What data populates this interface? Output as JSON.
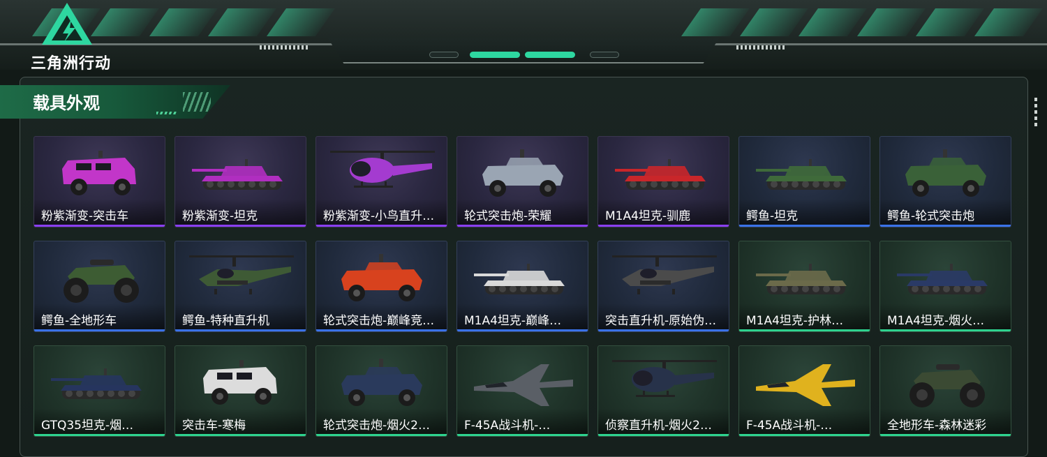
{
  "header": {
    "game_title": "三角洲行动",
    "colors": {
      "accent": "#2ed7a0",
      "panel": "#16201d"
    }
  },
  "section": {
    "title": "载具外观"
  },
  "rarity_colors": {
    "purple": "#8a3ff0",
    "blue": "#3a72e8",
    "green": "#2ed38f"
  },
  "cards": [
    {
      "name": "粉紫渐变-突击车",
      "rarity": "purple",
      "icon": "armored-car-icon",
      "paint": "#c236c9"
    },
    {
      "name": "粉紫渐变-坦克",
      "rarity": "purple",
      "icon": "tank-icon",
      "paint": "#b02ec0"
    },
    {
      "name": "粉紫渐变-小鸟直升…",
      "rarity": "purple",
      "icon": "helicopter-icon",
      "paint": "#a43bd0"
    },
    {
      "name": "轮式突击炮-荣耀",
      "rarity": "purple",
      "icon": "wheeled-vehicle-icon",
      "paint": "#9aa5b3"
    },
    {
      "name": "M1A4坦克-驯鹿",
      "rarity": "purple",
      "icon": "tank-icon",
      "paint": "#c9262a"
    },
    {
      "name": "鳄鱼-坦克",
      "rarity": "blue",
      "icon": "tank-icon",
      "paint": "#3f6a3a"
    },
    {
      "name": "鳄鱼-轮式突击炮",
      "rarity": "blue",
      "icon": "wheeled-vehicle-icon",
      "paint": "#3a6138"
    },
    {
      "name": "鳄鱼-全地形车",
      "rarity": "blue",
      "icon": "atv-icon",
      "paint": "#3d5c33"
    },
    {
      "name": "鳄鱼-特种直升机",
      "rarity": "blue",
      "icon": "attack-helicopter-icon",
      "paint": "#3e5a35"
    },
    {
      "name": "轮式突击炮-巅峰竞…",
      "rarity": "blue",
      "icon": "wheeled-vehicle-icon",
      "paint": "#d8421e"
    },
    {
      "name": "M1A4坦克-巅峰…",
      "rarity": "blue",
      "icon": "tank-icon",
      "paint": "#d9d9d9"
    },
    {
      "name": "突击直升机-原始伪…",
      "rarity": "blue",
      "icon": "attack-helicopter-icon",
      "paint": "#4b4b4b"
    },
    {
      "name": "M1A4坦克-护林…",
      "rarity": "green",
      "icon": "tank-icon",
      "paint": "#6b6a4a"
    },
    {
      "name": "M1A4坦克-烟火…",
      "rarity": "green",
      "icon": "tank-icon",
      "paint": "#2a3a66"
    },
    {
      "name": "GTQ35坦克-烟…",
      "rarity": "green",
      "icon": "tank-icon",
      "paint": "#26355e"
    },
    {
      "name": "突击车-寒梅",
      "rarity": "green",
      "icon": "armored-car-icon",
      "paint": "#dcdcdc"
    },
    {
      "name": "轮式突击炮-烟火2…",
      "rarity": "green",
      "icon": "wheeled-vehicle-icon",
      "paint": "#2a3a5c"
    },
    {
      "name": "F-45A战斗机-…",
      "rarity": "green",
      "icon": "fighter-jet-icon",
      "paint": "#5a5f66"
    },
    {
      "name": "侦察直升机-烟火2…",
      "rarity": "green",
      "icon": "helicopter-icon",
      "paint": "#27324a"
    },
    {
      "name": "F-45A战斗机-…",
      "rarity": "green",
      "icon": "fighter-jet-icon",
      "paint": "#e0b21e"
    },
    {
      "name": "全地形车-森林迷彩",
      "rarity": "green",
      "icon": "atv-icon",
      "paint": "#3b4a33"
    }
  ]
}
